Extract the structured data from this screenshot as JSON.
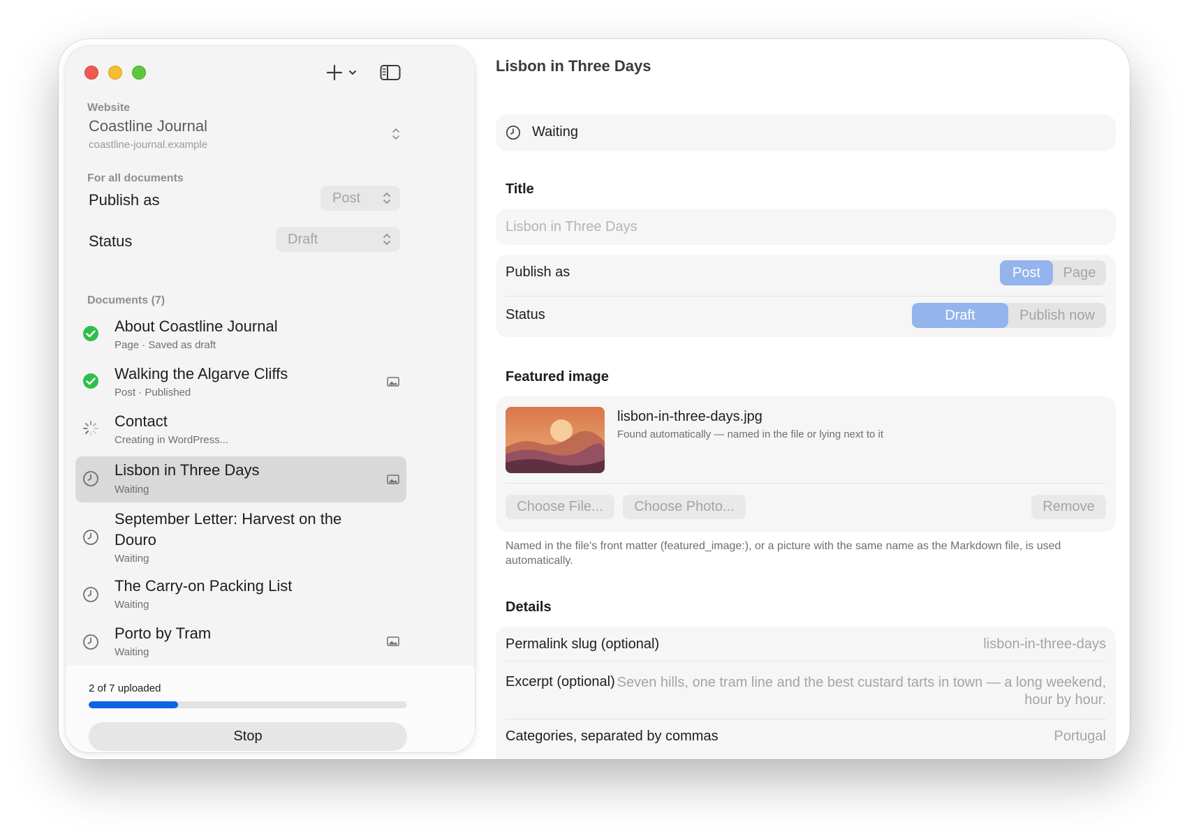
{
  "sidebar": {
    "website_label": "Website",
    "site_name": "Coastline Journal",
    "site_url": "coastline-journal.example",
    "for_all_label": "For all documents",
    "publish_as_label": "Publish as",
    "publish_as_value": "Post",
    "status_label": "Status",
    "status_value": "Draft",
    "documents_label": "Documents (7)",
    "documents": [
      {
        "title": "About Coastline Journal",
        "subtitle": "Page · Saved as draft",
        "state": "done",
        "has_image": false
      },
      {
        "title": "Walking the Algarve Cliffs",
        "subtitle": "Post · Published",
        "state": "done",
        "has_image": true
      },
      {
        "title": "Contact",
        "subtitle": "Creating in WordPress...",
        "state": "working",
        "has_image": false
      },
      {
        "title": "Lisbon in Three Days",
        "subtitle": "Waiting",
        "state": "waiting",
        "has_image": true,
        "selected": true
      },
      {
        "title": "September Letter: Harvest on the Douro",
        "subtitle": "Waiting",
        "state": "waiting",
        "has_image": false
      },
      {
        "title": "The Carry-on Packing List",
        "subtitle": "Waiting",
        "state": "waiting",
        "has_image": false
      },
      {
        "title": "Porto by Tram",
        "subtitle": "Waiting",
        "state": "waiting",
        "has_image": true
      }
    ],
    "upload_status": "2 of 7 uploaded",
    "upload_progress": 0.28,
    "stop_label": "Stop"
  },
  "main": {
    "title": "Lisbon in Three Days",
    "status_text": "Waiting",
    "title_section": "Title",
    "title_value": "Lisbon in Three Days",
    "publish_as_label": "Publish as",
    "publish_options": [
      "Post",
      "Page"
    ],
    "publish_selected": "Post",
    "status_label": "Status",
    "status_options": [
      "Draft",
      "Publish now"
    ],
    "status_selected": "Draft",
    "featured_section": "Featured image",
    "featured_filename": "lisbon-in-three-days.jpg",
    "featured_note": "Found automatically — named in the file or lying next to it",
    "choose_file": "Choose File...",
    "choose_photo": "Choose Photo...",
    "remove": "Remove",
    "help_text": "Named in the file's front matter (featured_image:), or a picture with the same name as the Markdown file, is used automatically.",
    "details_section": "Details",
    "slug_label": "Permalink slug (optional)",
    "slug_placeholder": "lisbon-in-three-days",
    "excerpt_label": "Excerpt (optional)",
    "excerpt_placeholder": "Seven hills, one tram line and the best custard tarts in town — a long weekend, hour by hour.",
    "categories_label": "Categories, separated by commas",
    "categories_placeholder": "Portugal"
  },
  "colors": {
    "accent": "#0b66e4",
    "segment_selected": "#93b4ec",
    "success": "#2fbf4b",
    "close": "#ee5a52",
    "minimize": "#f5bd2f",
    "zoom": "#5ec73f"
  }
}
